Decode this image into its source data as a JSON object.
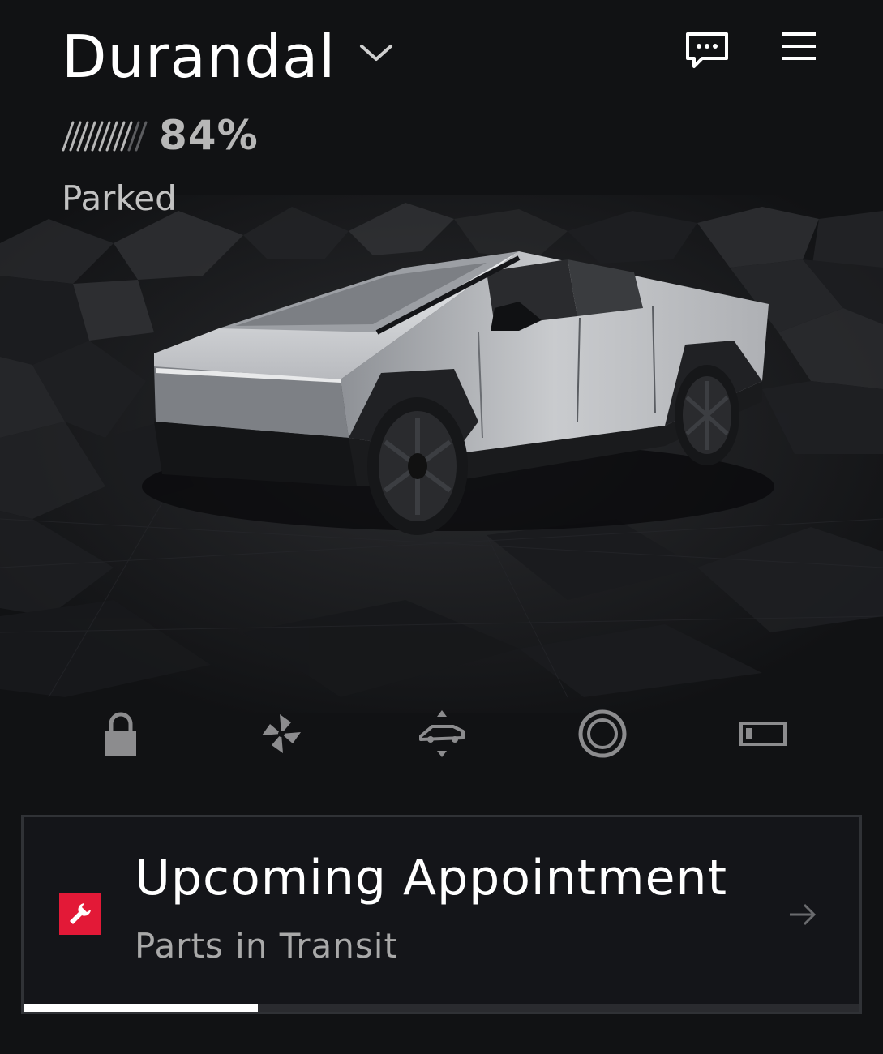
{
  "vehicle": {
    "name": "Durandal",
    "battery_percent": "84%",
    "status": "Parked"
  },
  "header": {
    "icons": [
      "chevron-down-icon",
      "messages-icon",
      "menu-icon"
    ]
  },
  "quick_controls": [
    {
      "icon": "lock-icon"
    },
    {
      "icon": "fan-icon"
    },
    {
      "icon": "suspension-icon"
    },
    {
      "icon": "tire-icon"
    },
    {
      "icon": "charge-port-icon"
    }
  ],
  "appointment": {
    "title": "Upcoming Appointment",
    "subtitle": "Parts in Transit",
    "progress": 0.28,
    "accent_color": "#e31937"
  },
  "colors": {
    "background": "#111214",
    "text_primary": "#ffffff",
    "text_secondary": "#a9a9a9",
    "accent": "#e31937"
  }
}
